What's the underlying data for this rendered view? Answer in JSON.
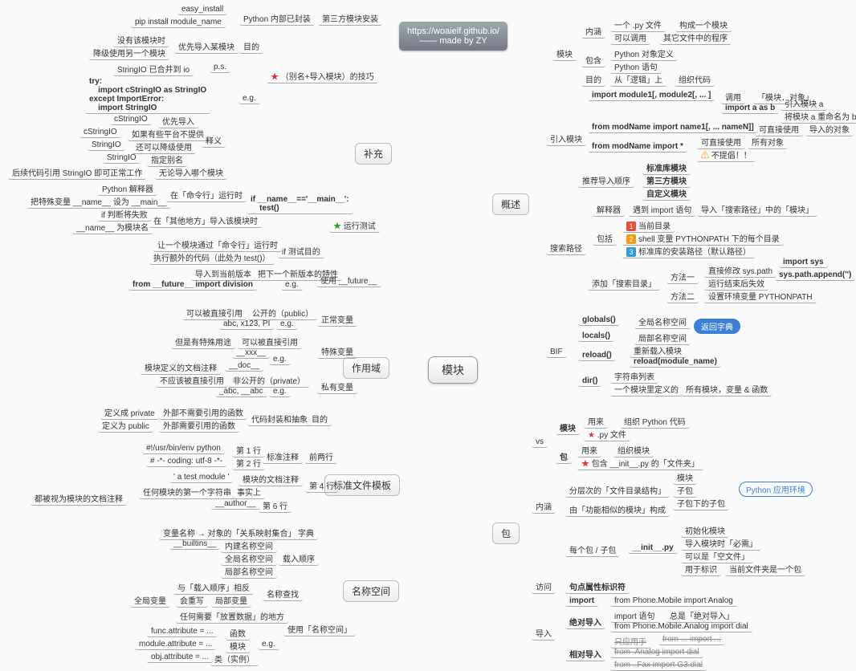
{
  "attribution": "https://woaielf.github.io/\n—— made by ZY",
  "center": "模块",
  "main": {
    "buchong": "补充",
    "zuoyongyu": "作用域",
    "biaozhun": "标准文件模板",
    "mingcheng": "名称空间",
    "gaishu": "概述",
    "bao": "包"
  },
  "L": {
    "pipcmd1": "easy_install",
    "pipcmd2": "pip install module_name",
    "py_internal": "Python 内部已封装",
    "third_party": "第三方模块安装",
    "no_mod": "没有该模块时",
    "use_other": "降级使用另一个模块",
    "prefer_import": "优先导入某模块",
    "mudi": "目的",
    "stringio_io": "StringIO 已合并到 io",
    "ps": "p.s.",
    "try_code": "try:\n    import cStringIO as StringIO\nexcept ImportError:\n    import StringIO",
    "eg": "e.g.",
    "alias_trick": "（别名+导入模块）的技巧",
    "cstr1": "cStringIO",
    "cstr1_v": "优先导入",
    "cstr2": "cStringIO",
    "cstr2_v": "如果有些平台不提供",
    "str1": "StringIO",
    "str1_v": "还可以降级使用",
    "shiyi": "释义",
    "str2": "StringIO",
    "str2_v": "指定别名",
    "yinyong": "后续代码引用 StringIO 即可正常工作",
    "yinyong_v": "无论导入哪个模块",
    "py_interp": "Python 解释器",
    "name_main": "把特殊变量 __name__ 设为 __main__",
    "cmd_run": "在「命令行」运行时",
    "if_fail": "if 判断将失败",
    "name_mod": "__name__ 为模块名",
    "other_import": "在「其他地方」导入该模块时",
    "ifmain": "if __name__=='__main__':\n    test()",
    "let_cmd": "让一个模块通过「命令行」运行时",
    "run_extra": "执行额外的代码（此处为 test()）",
    "if_test": "if 测试目的",
    "runtest": "运行测试",
    "old_import": "导入到当前版本",
    "new_feat": "把下一个新版本的特性",
    "use_future": "使用 __future__",
    "future_import": "from __future__ import division",
    "direct_ref": "可以被直接引用",
    "public": "公开的（public）",
    "normal_var": "正常变量",
    "abc_eg": "abc, x123, PI",
    "special_use": "但是有特殊用途",
    "can_ref": "可以被直接引用",
    "special_var": "特殊变量",
    "xxx": "__xxx__",
    "doc": "__doc__",
    "doc_v": "模块定义的文档注释",
    "no_direct": "不应该被直接引用",
    "private": "非公开的（private）",
    "private_var": "私有变量",
    "abc_priv": "_abc, __abc",
    "def_priv": "定义成 private",
    "no_need": "外部不需要引用的函数",
    "def_pub": "定义为 public",
    "need_ext": "外部需要引用的函数",
    "encap": "代码封装和抽象",
    "shebang": "#!/usr/bin/env python",
    "line1": "第 1 行",
    "coding": "# -*- coding: utf-8 -*-",
    "line2": "第 2 行",
    "std_comment": "标准注释",
    "first2": "前两行",
    "testmod": "' a test module '",
    "mod_doc": "模块的文档注释",
    "any_first": "任何模块的第一个字符串",
    "actually": "事实上",
    "line4": "第 4 行",
    "regard": "都被视为模块的文档注释",
    "author": "__author__",
    "line6": "第 6 行",
    "varname": "变量名称 → 对象的「关系映射集合」",
    "dict": "字典",
    "builtins": "__builtins__",
    "builtin_ns": "内建名称空间",
    "global_ns": "全局名称空间",
    "local_ns": "局部名称空间",
    "load_order": "载入顺序",
    "reverse": "与「载入顺序」相反",
    "name_lookup": "名称查找",
    "global_var": "全局变量",
    "func": "函数",
    "local_var": "局部变量",
    "huizhong": "会重写",
    "store": "任何需要「放置数据」的地方",
    "use_ns": "使用「名称空间」",
    "fa": "func.attribute = ...",
    "fa_v": "函数",
    "ma": "module.attribute = ...",
    "ma_v": "模块",
    "oa": "obj.attribute = ...",
    "oa_v": "类（实例）"
  },
  "R": {
    "neihan": "内涵",
    "pyfile": "一个 .py 文件",
    "pyfile_v": "构成一个模块",
    "call": "可以调用",
    "call_v": "其它文件中的程序",
    "baohan": "包含",
    "pyobj": "Python 对象定义",
    "pystmt": "Python 语句",
    "mod_mudi": "目的",
    "logic": "从「逻辑」上",
    "org_code": "组织代码",
    "mokuai": "模块",
    "import_m": "import module1[, module2[, ... ]",
    "diaoyong": "调用",
    "mod_obj": "「模块．对象」",
    "import_ab": "import a as b",
    "yinru_a": "引入模块 a",
    "rename": "将模块 a 重命名为 b",
    "from_name": "from modName import name1[, ... nameN]]",
    "direct_use": "可直接使用",
    "imported_obj": "导入的对象",
    "from_star": "from modName import *",
    "direct_use2": "可直接使用",
    "all_obj": "所有对象",
    "not_rec": "不提倡！！",
    "yinru": "引入模块",
    "rec_order": "推荐导入顺序",
    "std_mod": "标准库模块",
    "third_mod": "第三方模块",
    "self_mod": "自定义模块",
    "interpreter": "解释器",
    "meet_import": "遇到 import 语句",
    "import_path": "导入「搜索路径」中的「模块」",
    "baokuo": "包括",
    "cur_dir": "当前目录",
    "pythonpath": "shell 变量 PYTHONPATH 下的每个目录",
    "std_path": "标准库的安装路径（默认路径）",
    "sousuo": "搜索路径",
    "add_path": "添加「搜索目录」",
    "method1": "方法一",
    "modify_sys": "直接修改 sys.path",
    "import_sys": "import sys",
    "sys_append": "sys.path.append('')",
    "end_fail": "运行结束后失效",
    "method2": "方法二",
    "set_env": "设置环境变量 PYTHONPATH",
    "bif": "BIF",
    "globals": "globals()",
    "global_ns2": "全局名称空间",
    "return_dict": "返回字典",
    "locals": "locals()",
    "local_ns2": "局部名称空间",
    "reload": "reload()",
    "reimport": "重新载入模块",
    "reload_code": "reload(module_name)",
    "dir": "dir()",
    "str_list": "字符串列表",
    "mod_def": "一个模块里定义的",
    "all_vars": "所有模块，变量 & 函数",
    "vs": "vs",
    "mokuai2": "模块",
    "yonglai1": "用来",
    "org_py": "组织 Python 代码",
    "pyfile2": ".py 文件",
    "bao2": "包",
    "yonglai2": "用来",
    "org_mod": "组织模块",
    "init_folder": "包含 __init__.py 的「文件夹」",
    "neihan2": "内涵",
    "layered": "分层次的「文件目录结构」",
    "mod3": "模块",
    "subpkg": "子包",
    "subsub": "子包下的子包",
    "py_env": "Python 应用环境",
    "similar": "由「功能相似的模块」构成",
    "each_pkg": "每个包 / 子包",
    "init_py": "__init__.py",
    "init_mod": "初始化模块",
    "import_req": "导入模块时「必需」",
    "empty": "可以是「空文件」",
    "mark": "用于标识",
    "is_pkg": "当前文件夹是一个包",
    "visit": "访问",
    "dot_attr": "句点属性标识符",
    "daoru": "导入",
    "import_kw": "import",
    "from_analog": "from Phone.Mobile import Analog",
    "abs_import": "绝对导入",
    "import_stmt": "import 语句",
    "always_abs": "总是「绝对导入」",
    "from_dial": "from Phone.Mobile.Analog import dial",
    "rel_import": "相对导入",
    "only_for": "只应用于",
    "from_dot": "from ... import ...",
    "from_analog2": "from .Analog import dial",
    "from_fax": "from ..Fax import G3.dial"
  }
}
